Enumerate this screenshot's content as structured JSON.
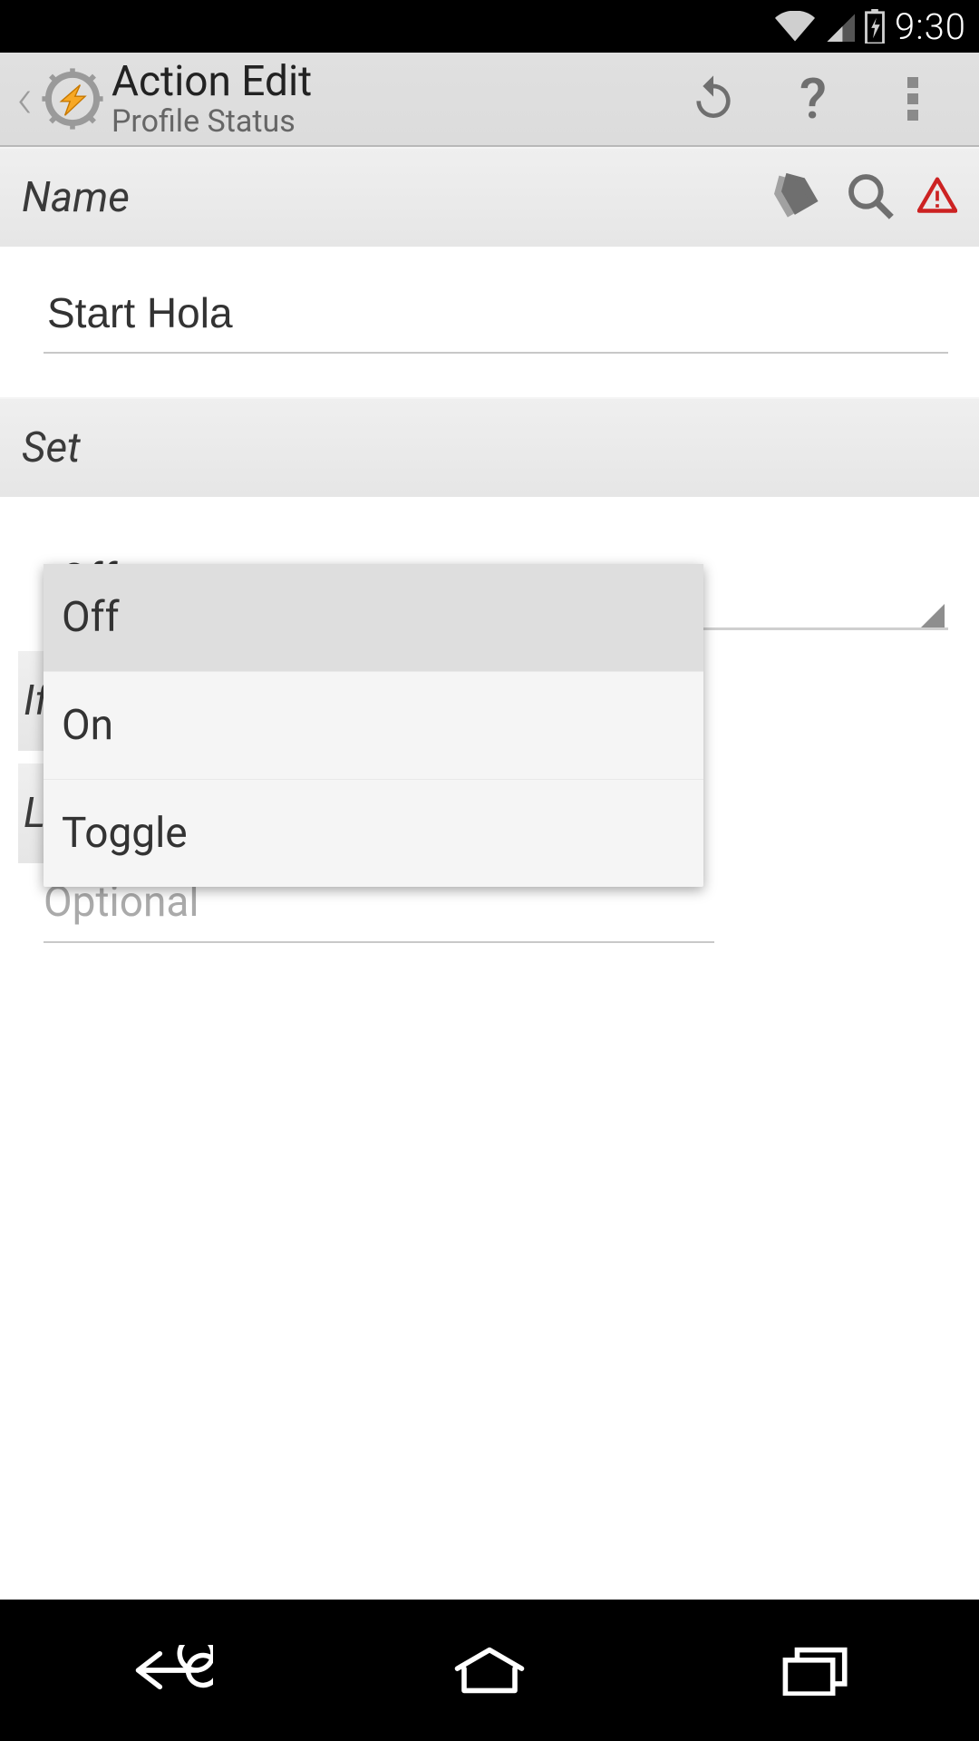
{
  "status": {
    "time": "9:30"
  },
  "header": {
    "title": "Action Edit",
    "subtitle": "Profile Status"
  },
  "sections": {
    "name": {
      "label": "Name",
      "value": "Start Hola"
    },
    "set": {
      "label": "Set",
      "selected": "Off",
      "options": [
        "Off",
        "On",
        "Toggle"
      ]
    },
    "if_label": "If",
    "l_label": "L",
    "optional_hint": "Optional"
  }
}
